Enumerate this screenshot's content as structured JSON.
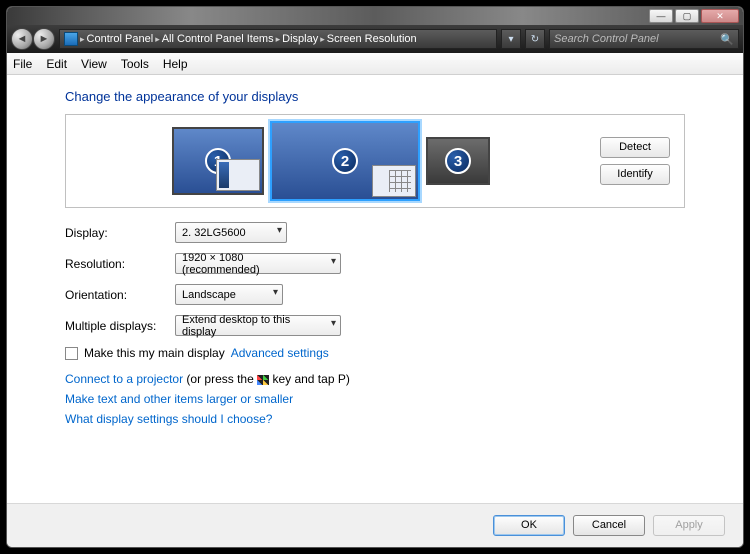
{
  "window": {
    "min": "—",
    "max": "▢",
    "close": "✕"
  },
  "nav": {
    "back": "◄",
    "fwd": "►"
  },
  "breadcrumb": {
    "items": [
      "Control Panel",
      "All Control Panel Items",
      "Display",
      "Screen Resolution"
    ],
    "sep": "▸"
  },
  "search": {
    "placeholder": "Search Control Panel",
    "icon": "🔍"
  },
  "menu": [
    "File",
    "Edit",
    "View",
    "Tools",
    "Help"
  ],
  "heading": "Change the appearance of your displays",
  "side_buttons": {
    "detect": "Detect",
    "identify": "Identify"
  },
  "monitors": [
    {
      "num": "1",
      "w": 92,
      "h": 68,
      "sel": false,
      "dark": false,
      "thumb": "tb"
    },
    {
      "num": "2",
      "w": 150,
      "h": 80,
      "sel": true,
      "dark": false,
      "thumb": "grid"
    },
    {
      "num": "3",
      "w": 64,
      "h": 48,
      "sel": false,
      "dark": true,
      "thumb": ""
    }
  ],
  "form": {
    "display_label": "Display:",
    "display_value": "2. 32LG5600",
    "resolution_label": "Resolution:",
    "resolution_value": "1920 × 1080 (recommended)",
    "orientation_label": "Orientation:",
    "orientation_value": "Landscape",
    "multi_label": "Multiple displays:",
    "multi_value": "Extend desktop to this display"
  },
  "checkbox_label": "Make this my main display",
  "advanced": "Advanced settings",
  "links": {
    "projector_link": "Connect to a projector",
    "projector_suffix": " (or press the ",
    "projector_suffix2": " key and tap P)",
    "textsize": "Make text and other items larger or smaller",
    "help": "What display settings should I choose?"
  },
  "footer": {
    "ok": "OK",
    "cancel": "Cancel",
    "apply": "Apply"
  }
}
